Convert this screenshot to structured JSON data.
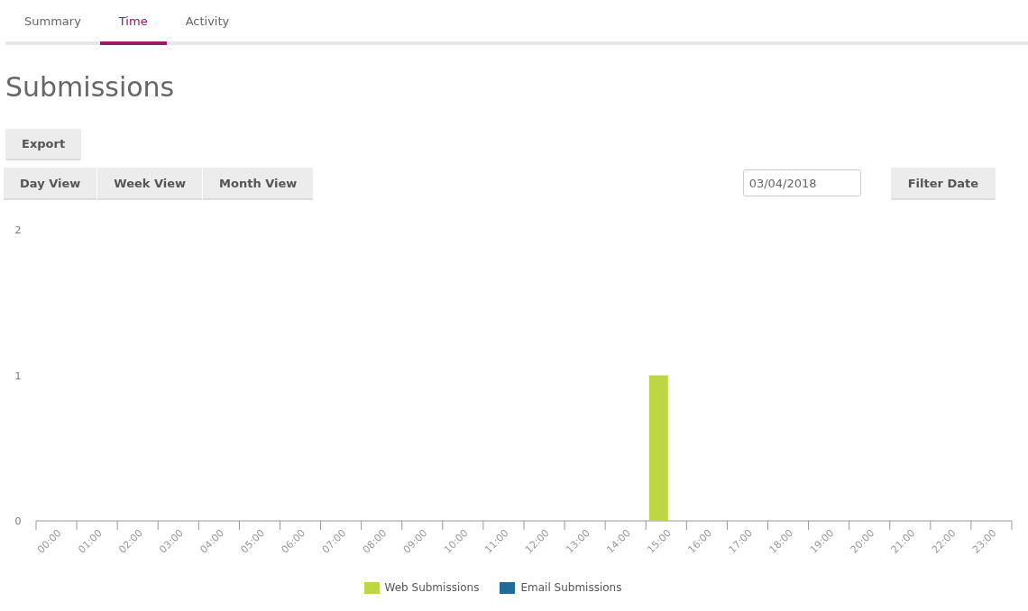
{
  "tabs": [
    {
      "label": "Summary",
      "selected": false
    },
    {
      "label": "Time",
      "selected": true
    },
    {
      "label": "Activity",
      "selected": false
    }
  ],
  "title": "Submissions",
  "export_button": "Export",
  "view_buttons": [
    "Day View",
    "Week View",
    "Month View"
  ],
  "date_field": {
    "value": "03/04/2018"
  },
  "filter_button": "Filter Date",
  "chart_data": {
    "type": "bar",
    "categories": [
      "00:00",
      "01:00",
      "02:00",
      "03:00",
      "04:00",
      "05:00",
      "06:00",
      "07:00",
      "08:00",
      "09:00",
      "10:00",
      "11:00",
      "12:00",
      "13:00",
      "14:00",
      "15:00",
      "16:00",
      "17:00",
      "18:00",
      "19:00",
      "20:00",
      "21:00",
      "22:00",
      "23:00"
    ],
    "series": [
      {
        "name": "Web Submissions",
        "color": "#bdd643",
        "values": [
          0,
          0,
          0,
          0,
          0,
          0,
          0,
          0,
          0,
          0,
          0,
          0,
          0,
          0,
          0,
          1,
          0,
          0,
          0,
          0,
          0,
          0,
          0,
          0
        ]
      },
      {
        "name": "Email Submissions",
        "color": "#216b9b",
        "values": [
          0,
          0,
          0,
          0,
          0,
          0,
          0,
          0,
          0,
          0,
          0,
          0,
          0,
          0,
          0,
          0,
          0,
          0,
          0,
          0,
          0,
          0,
          0,
          0
        ]
      }
    ],
    "ylim": [
      0,
      2
    ],
    "yticks": [
      0,
      1,
      2
    ]
  }
}
